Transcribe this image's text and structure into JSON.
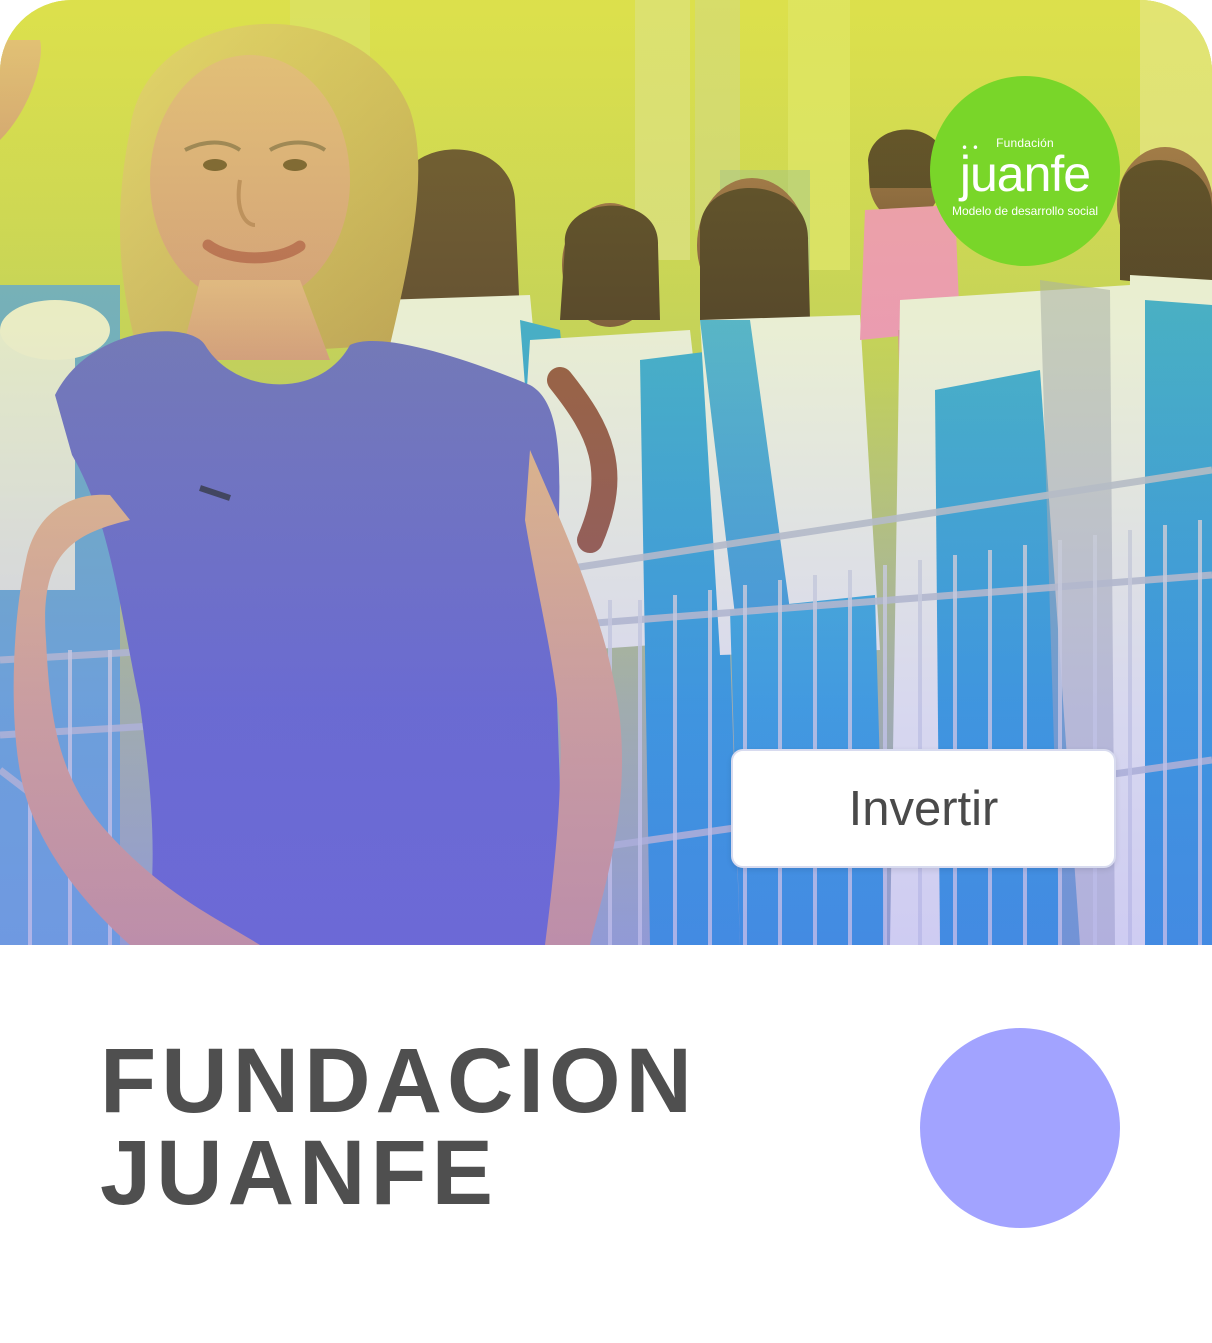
{
  "logo": {
    "small_label": "Fundación",
    "main_label": "juanfe",
    "tagline": "Modelo de desarrollo social",
    "background_color": "#79d629",
    "text_color": "#ffffff"
  },
  "hero": {
    "description_icon": "photo-icon"
  },
  "actions": {
    "invest_label": "Invertir"
  },
  "title": {
    "line1": "FUNDACION",
    "line2": "JUANFE"
  },
  "colors": {
    "title": "#4f4f4f",
    "accent_circle": "#a2a3ff",
    "button_border": "#d8dbef",
    "button_text": "#4a4a4a"
  }
}
